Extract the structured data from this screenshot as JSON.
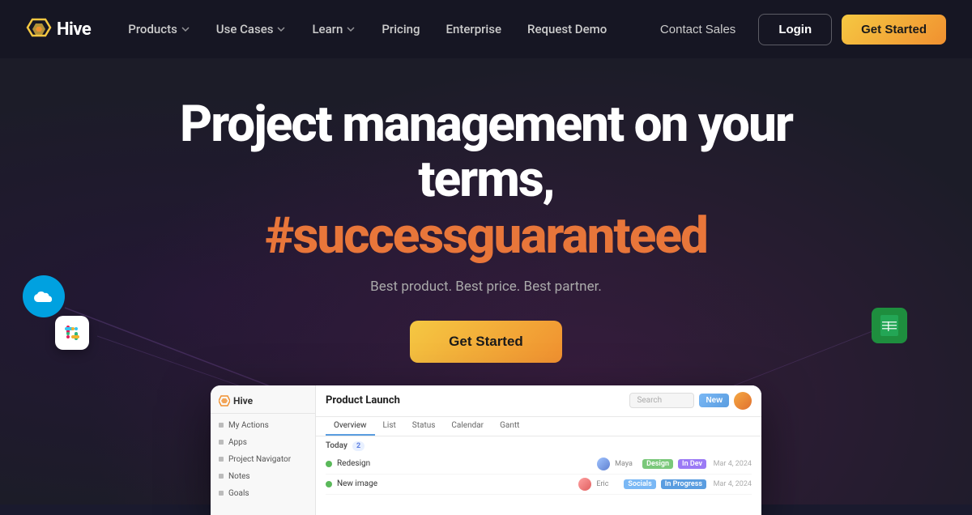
{
  "nav": {
    "logo_text": "Hive",
    "items": [
      {
        "label": "Products",
        "has_dropdown": true
      },
      {
        "label": "Use Cases",
        "has_dropdown": true
      },
      {
        "label": "Learn",
        "has_dropdown": true
      },
      {
        "label": "Pricing",
        "has_dropdown": false
      },
      {
        "label": "Enterprise",
        "has_dropdown": false
      },
      {
        "label": "Request Demo",
        "has_dropdown": false
      }
    ],
    "contact_sales": "Contact Sales",
    "login": "Login",
    "get_started": "Get Started"
  },
  "hero": {
    "title_line1": "Project management on your terms,",
    "title_line2": "#successguaranteed",
    "subtitle": "Best product. Best price. Best partner.",
    "cta": "Get Started"
  },
  "app_preview": {
    "project_title": "Product Launch",
    "search_placeholder": "Search",
    "new_button": "New",
    "sidebar": {
      "logo": "Hive",
      "items": [
        "My Actions",
        "Apps",
        "Project Navigator",
        "Notes",
        "Goals"
      ]
    },
    "tabs": [
      "Overview",
      "List",
      "Status",
      "Calendar",
      "Gantt"
    ],
    "active_tab": "Overview",
    "today_label": "Today",
    "today_count": "2",
    "tasks": [
      {
        "name": "Redesign",
        "person": "Maya",
        "tag": "Design",
        "tag_class": "tag-design",
        "status": "In Dev",
        "status_class": "tag-indev",
        "date": "Mar 4, 2024"
      },
      {
        "name": "New image",
        "person": "Eric",
        "tag": "Socials",
        "tag_class": "tag-socials",
        "status": "In Progress",
        "status_class": "tag-inprogress",
        "date": "Mar 4, 2024"
      }
    ]
  },
  "floating_icons": {
    "salesforce": "☁",
    "slack": "⚡",
    "sheets": "▦"
  },
  "colors": {
    "accent_orange": "#e8763a",
    "accent_yellow": "#f5c842",
    "bg_dark": "#1c1c28",
    "nav_bg": "rgba(22,22,35,0.95)"
  }
}
